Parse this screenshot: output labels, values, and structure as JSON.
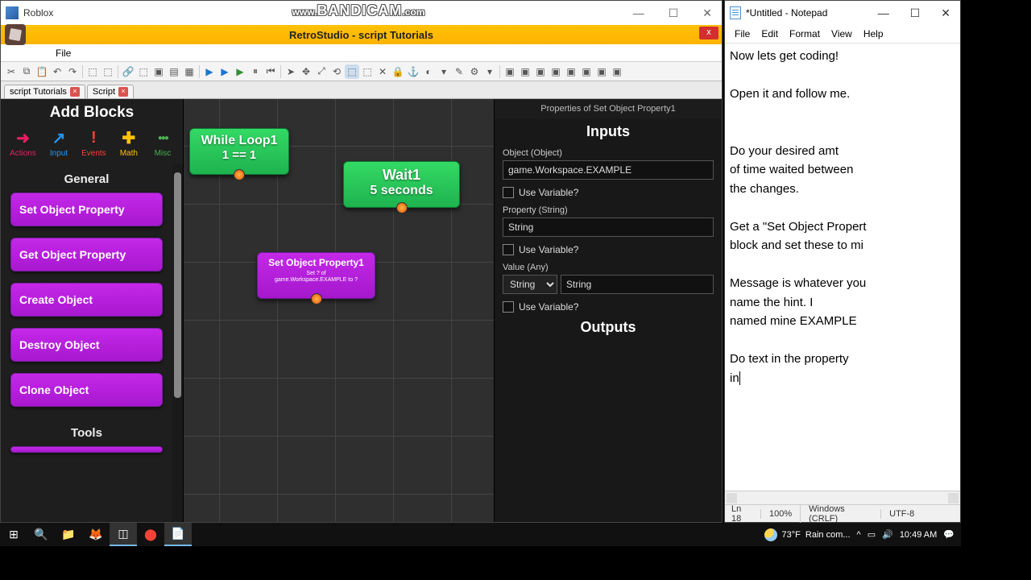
{
  "roblox": {
    "title": "Roblox",
    "orange_title": "RetroStudio - script Tutorials",
    "close_x": "x",
    "menu": {
      "file": "File"
    },
    "tabs": [
      {
        "label": "script Tutorials"
      },
      {
        "label": "Script"
      }
    ]
  },
  "add_blocks": {
    "title": "Add Blocks",
    "cats": {
      "actions": "Actions",
      "input": "Input",
      "events": "Events",
      "math": "Math",
      "misc": "Misc"
    },
    "general_title": "General",
    "blocks": [
      "Set Object Property",
      "Get Object Property",
      "Create Object",
      "Destroy Object",
      "Clone Object"
    ],
    "tools_title": "Tools"
  },
  "canvas": {
    "while": {
      "title": "While Loop1",
      "sub": "1 == 1"
    },
    "wait": {
      "title": "Wait1",
      "sub": "5 seconds"
    },
    "setprop": {
      "title": "Set Object Property1",
      "sub": "Set ? of\ngame.Workspace.EXAMPLE to ?"
    }
  },
  "props": {
    "title": "Properties of Set Object Property1",
    "inputs_h": "Inputs",
    "outputs_h": "Outputs",
    "object_label": "Object (Object)",
    "object_value": "game.Workspace.EXAMPLE",
    "use_var": "Use Variable?",
    "property_label": "Property (String)",
    "property_value": "String",
    "value_label": "Value (Any)",
    "value_type": "String",
    "value_value": "String"
  },
  "notepad": {
    "title": "*Untitled - Notepad",
    "menu": {
      "file": "File",
      "edit": "Edit",
      "format": "Format",
      "view": "View",
      "help": "Help"
    },
    "body": "Now lets get coding!\n\nOpen it and follow me.\n\n\nDo your desired amt\nof time waited between\nthe changes.\n\nGet a \"Set Object Propert\nblock and set these to mi\n\nMessage is whatever you\nname the hint. I\nnamed mine EXAMPLE\n\nDo text in the property\nin",
    "status": {
      "ln": "Ln 18",
      "zoom": "100%",
      "enc": "Windows (CRLF)",
      "utf": "UTF-8"
    }
  },
  "taskbar": {
    "weather_temp": "73°F",
    "weather_text": "Rain com...",
    "time": "10:49 AM"
  },
  "watermark": "www.BANDICAM.com"
}
